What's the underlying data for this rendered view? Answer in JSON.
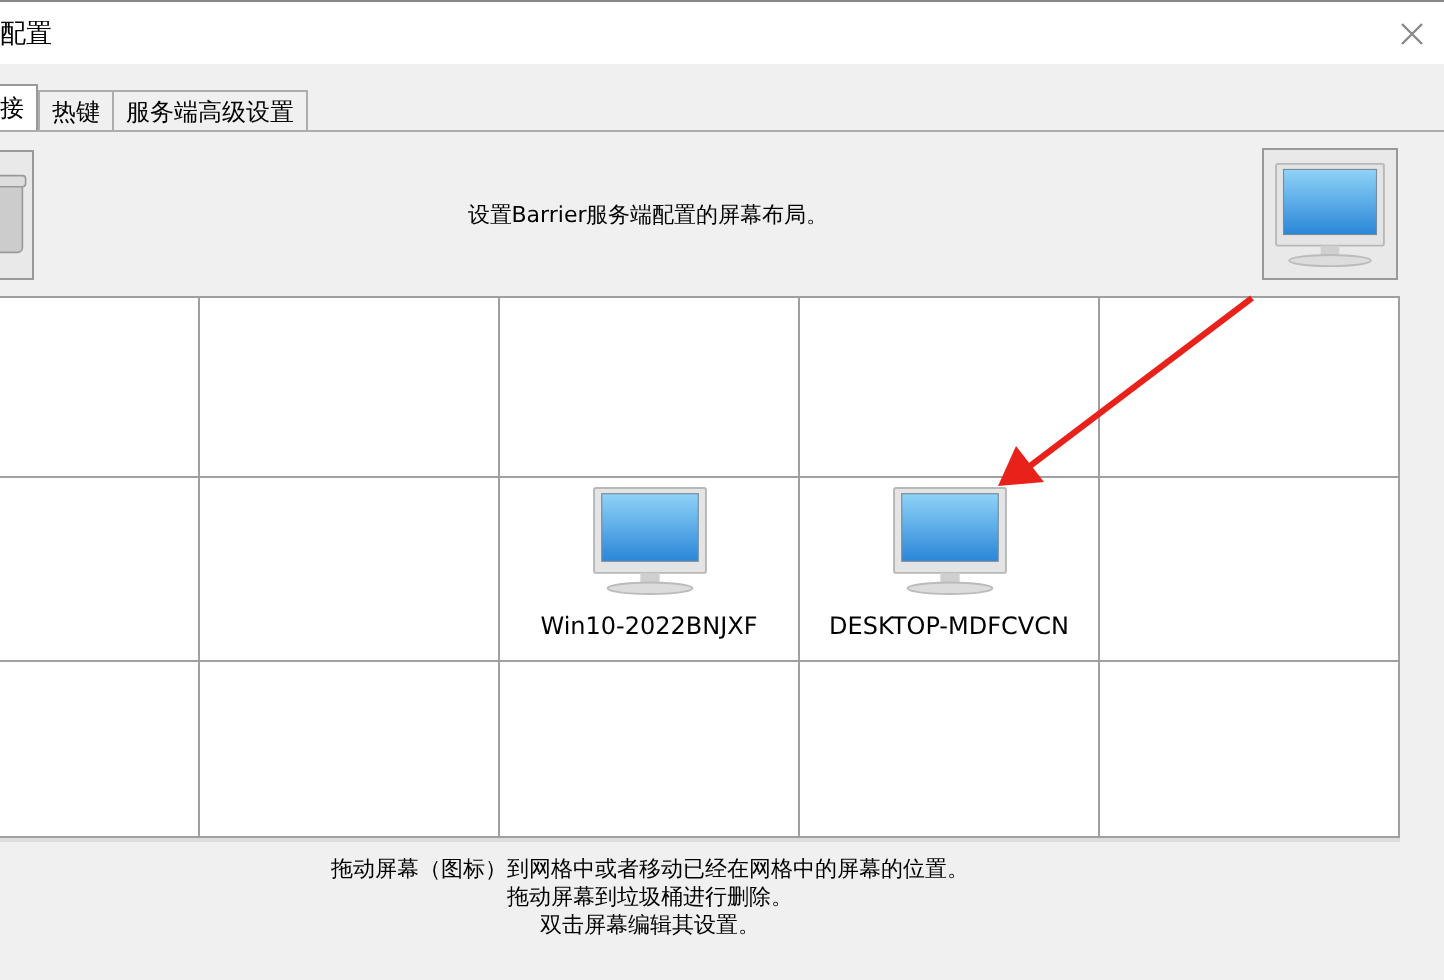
{
  "window": {
    "title": "配置"
  },
  "tabs": [
    {
      "label": "接",
      "selected": true
    },
    {
      "label": "热键",
      "selected": false
    },
    {
      "label": "服务端高级设置",
      "selected": false
    }
  ],
  "layout_panel": {
    "hint": "设置Barrier服务端配置的屏幕布局。"
  },
  "grid": {
    "rows": [
      [
        {},
        {},
        {},
        {},
        {}
      ],
      [
        {},
        {},
        {
          "screen": "Win10-2022BNJXF"
        },
        {
          "screen": "DESKTOP-MDFCVCN"
        },
        {}
      ],
      [
        {},
        {},
        {},
        {},
        {}
      ]
    ]
  },
  "instructions": [
    "拖动屏幕（图标）到网格中或者移动已经在网格中的屏幕的位置。",
    "拖动屏幕到垃圾桶进行删除。",
    "双击屏幕编辑其设置。"
  ]
}
